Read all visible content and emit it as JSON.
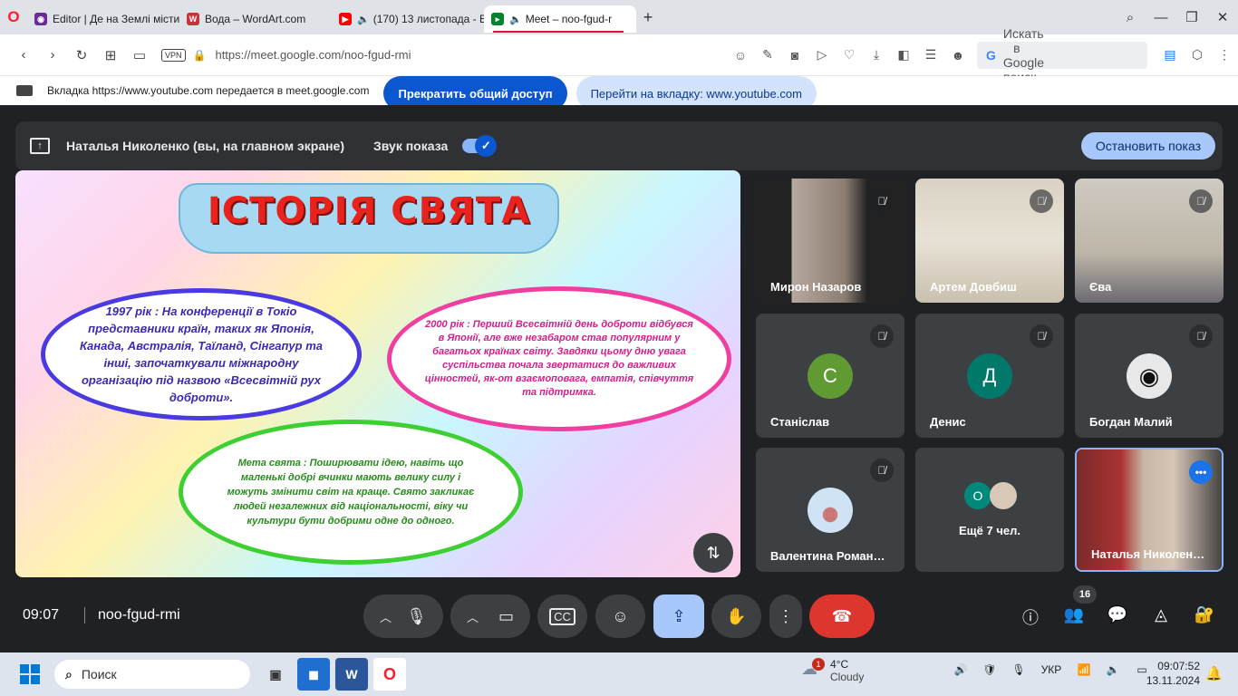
{
  "browser": {
    "tabs": [
      {
        "title": "Editor | Де на Землі місти",
        "icon": "editor-icon",
        "color": "#6b2a9a"
      },
      {
        "title": "Вода – WordArt.com",
        "icon": "wordart-icon",
        "color": "#c8323a"
      },
      {
        "title": "(170) 13 листопада - E",
        "icon": "youtube-icon",
        "color": "#ff0000"
      },
      {
        "title": "Meet – noo-fgud-r",
        "icon": "meet-icon",
        "color": "#00832d"
      }
    ],
    "url": "https://meet.google.com/noo-fgud-rmi",
    "vpn_label": "VPN",
    "search_placeholder": "Искать в Google поиск"
  },
  "share_bar": {
    "text": "Вкладка https://www.youtube.com передается в meet.google.com",
    "stop_label": "Прекратить общий доступ",
    "go_label": "Перейти на вкладку: www.youtube.com"
  },
  "presenting_banner": {
    "presenter": "Наталья Николенко (вы, на главном экране)",
    "sound_label": "Звук показа",
    "sound_on": true,
    "stop_label": "Остановить показ"
  },
  "slide": {
    "title": "ІСТОРІЯ СВЯТА",
    "cloud1": "1997 рік : На конференції в Токіо представники країн, таких як Японія, Канада, Австралія, Таїланд, Сінгапур та інші, започаткували міжнародну організацію під назвою «Всесвітній рух доброти».",
    "cloud2": "2000 рік : Перший Всесвітній день доброти відбувся в Японії, але вже незабаром став популярним у багатьох країнах світу. Завдяки цьому дню увага суспільства почала звертатися до важливих цінностей, як-от взаємоповага, емпатія, співчуття та підтримка.",
    "cloud3": "Мета свята : Поширювати ідею, навіть що маленькі добрі вчинки мають велику силу і можуть змінити світ на краще. Свято закликає людей незалежних від національності, віку чи культури бути добрими одне до одного."
  },
  "participants": [
    {
      "name": "Мирон Назаров",
      "type": "video",
      "muted": true
    },
    {
      "name": "Артем Довбиш",
      "type": "video",
      "muted": true
    },
    {
      "name": "Єва",
      "type": "video",
      "muted": true
    },
    {
      "name": "Станіслав",
      "type": "avatar",
      "letter": "С",
      "color": "#5f9a33",
      "muted": true
    },
    {
      "name": "Денис",
      "type": "avatar",
      "letter": "Д",
      "color": "#00796b",
      "muted": true
    },
    {
      "name": "Богдан Малий",
      "type": "avatar",
      "letter": "",
      "color": "#e8e8e8",
      "muted": true
    },
    {
      "name": "Валентина Роман…",
      "type": "avatar",
      "letter": "",
      "color": "#cfe3f5",
      "muted": true
    },
    {
      "name": "Ещё 7 чел.",
      "type": "more",
      "letter": "О",
      "color": "#00897b"
    },
    {
      "name": "Наталья Николен…",
      "type": "video",
      "self": true
    }
  ],
  "bottom": {
    "time": "09:07",
    "meeting_code": "noo-fgud-rmi",
    "people_count": "16"
  },
  "taskbar": {
    "search_placeholder": "Поиск",
    "weather_temp": "4°C",
    "weather_text": "Cloudy",
    "weather_badge": "1",
    "lang": "УКР",
    "time": "09:07:52",
    "date": "13.11.2024"
  }
}
